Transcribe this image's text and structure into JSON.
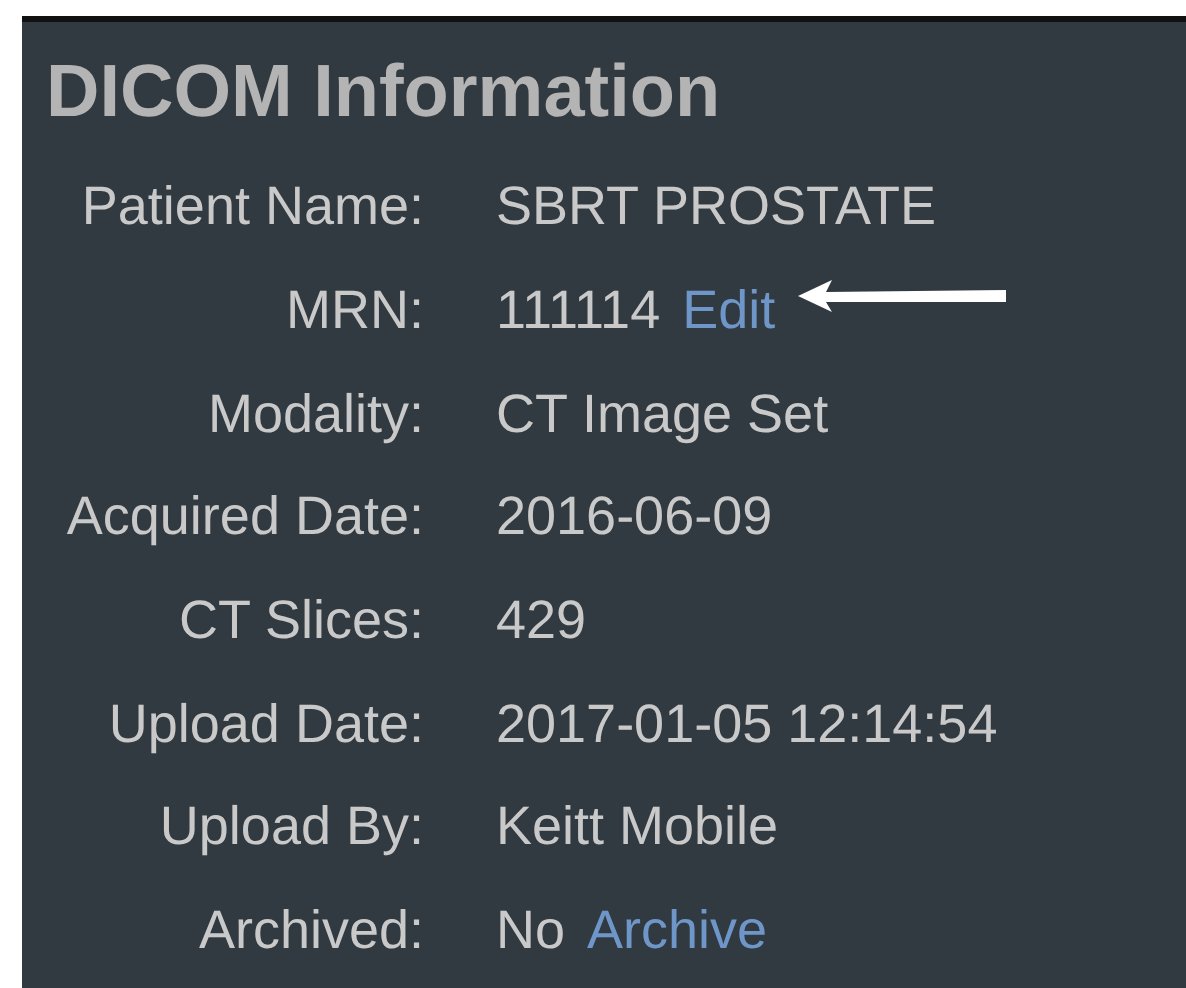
{
  "panel": {
    "title": "DICOM Information",
    "rows": [
      {
        "label": "Patient Name:",
        "value": "SBRT PROSTATE"
      },
      {
        "label": "MRN:",
        "value": "111114",
        "link": "Edit",
        "arrow": true
      },
      {
        "label": "Modality:",
        "value": "CT Image Set"
      },
      {
        "label": "Acquired Date:",
        "value": "2016-06-09"
      },
      {
        "label": "CT Slices:",
        "value": "429"
      },
      {
        "label": "Upload Date:",
        "value": "2017-01-05 12:14:54"
      },
      {
        "label": "Upload By:",
        "value": "Keitt Mobile"
      },
      {
        "label": "Archived:",
        "value": "No",
        "link": "Archive"
      }
    ]
  }
}
